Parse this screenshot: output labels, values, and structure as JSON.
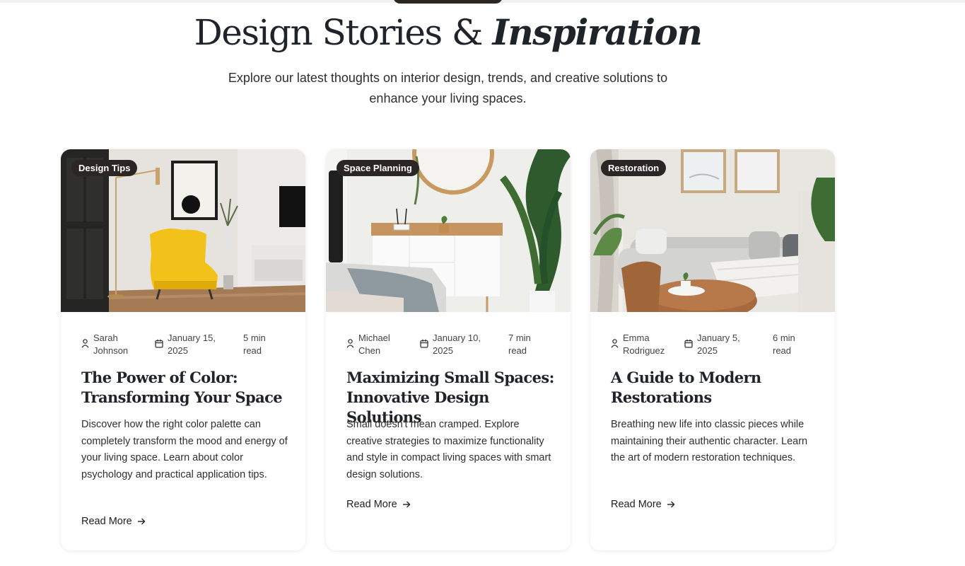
{
  "hero": {
    "title_regular": "Design Stories &",
    "title_accent": "Inspiration",
    "subtitle": "Explore our latest thoughts on interior design, trends, and creative solutions to enhance your living spaces."
  },
  "cards": [
    {
      "category": "Design Tips",
      "author": "Sarah Johnson",
      "date": "January 15, 2025",
      "read_time": "5 min read",
      "title": "The Power of Color: Transforming Your Space",
      "excerpt": "Discover how the right color palette can completely transform the mood and energy of your living space. Learn about color psychology and practical application tips.",
      "cta": "Read More"
    },
    {
      "category": "Space Planning",
      "author": "Michael Chen",
      "date": "January 10, 2025",
      "read_time": "7 min read",
      "title": "Maximizing Small Spaces: Innovative Design Solutions",
      "excerpt": "Small doesn't mean cramped. Explore creative strategies to maximize functionality and style in compact living spaces with smart design solutions.",
      "cta": "Read More"
    },
    {
      "category": "Restoration",
      "author": "Emma Rodriguez",
      "date": "January 5, 2025",
      "read_time": "6 min read",
      "title": "A Guide to Modern Restorations",
      "excerpt": "Breathing new life into classic pieces while maintaining their authentic character. Learn the art of modern restoration techniques.",
      "cta": "Read More"
    }
  ],
  "icons": {
    "author": "user-icon",
    "date": "calendar-icon",
    "cta": "arrow-right-icon"
  },
  "colors": {
    "tag_background": "#2b2624",
    "heading": "#1f232a"
  }
}
